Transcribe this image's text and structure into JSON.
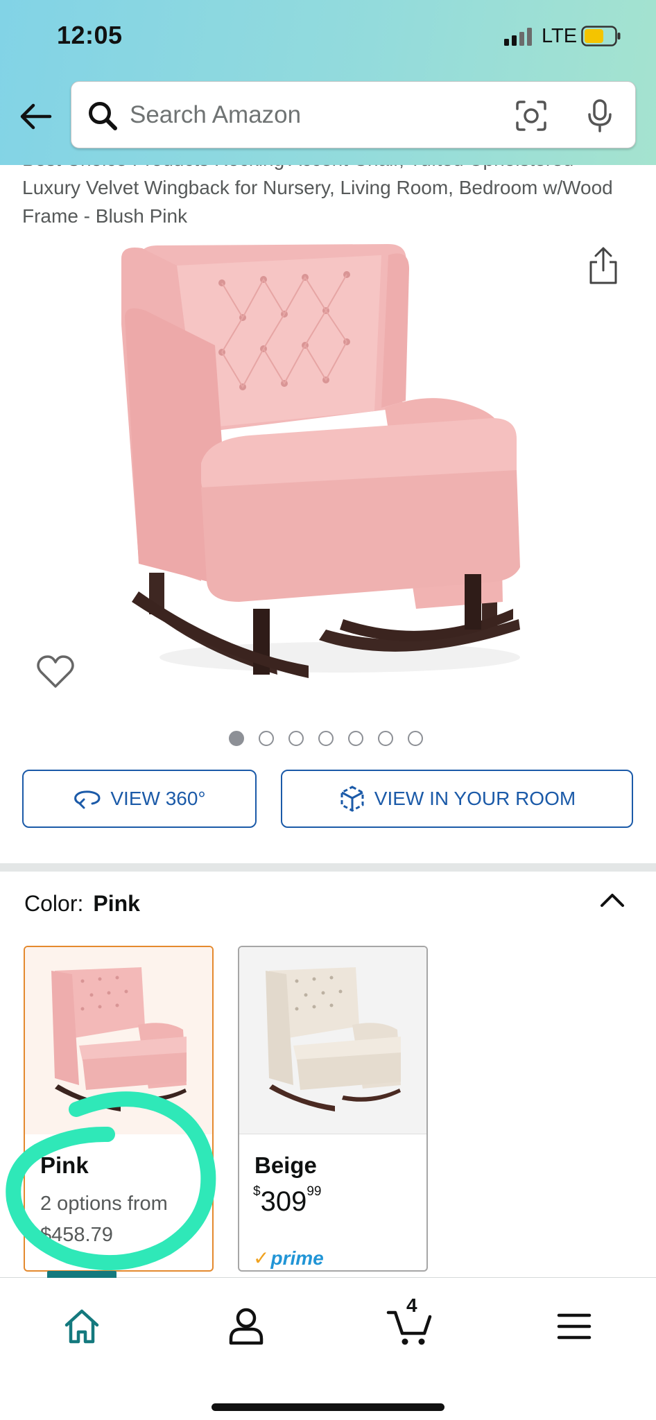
{
  "status_bar": {
    "time": "12:05",
    "network": "LTE"
  },
  "search": {
    "placeholder": "Search Amazon",
    "value": ""
  },
  "product": {
    "title": "Best Choice Products Rocking Accent Chair, Tufted Upholstered Luxury Velvet Wingback for Nursery, Living Room, Bedroom w/Wood Frame - Blush Pink",
    "image_count": 7,
    "active_image": 1
  },
  "actions": {
    "view_360": "VIEW 360°",
    "view_in_room": "VIEW IN YOUR ROOM"
  },
  "color": {
    "label": "Color:",
    "selected": "Pink",
    "options": [
      {
        "name": "Pink",
        "description": "2 options from $458.79",
        "selected": true
      },
      {
        "name": "Beige",
        "price_symbol": "$",
        "price_whole": "309",
        "price_fraction": "99",
        "badge": "prime",
        "selected": false
      }
    ]
  },
  "cart": {
    "count": "4"
  },
  "colors": {
    "header_start": "#82d3e6",
    "header_end": "#a5e3cf",
    "link_blue": "#1b5aa8",
    "selected_border": "#e4892e",
    "annotation": "#2fe8b8",
    "nav_active": "#14797e",
    "prime": "#2195d6"
  },
  "icons": [
    "back-arrow",
    "search",
    "camera",
    "microphone",
    "share",
    "heart",
    "rotate-360",
    "cube-ar",
    "chevron-up",
    "home",
    "account",
    "cart",
    "menu"
  ]
}
